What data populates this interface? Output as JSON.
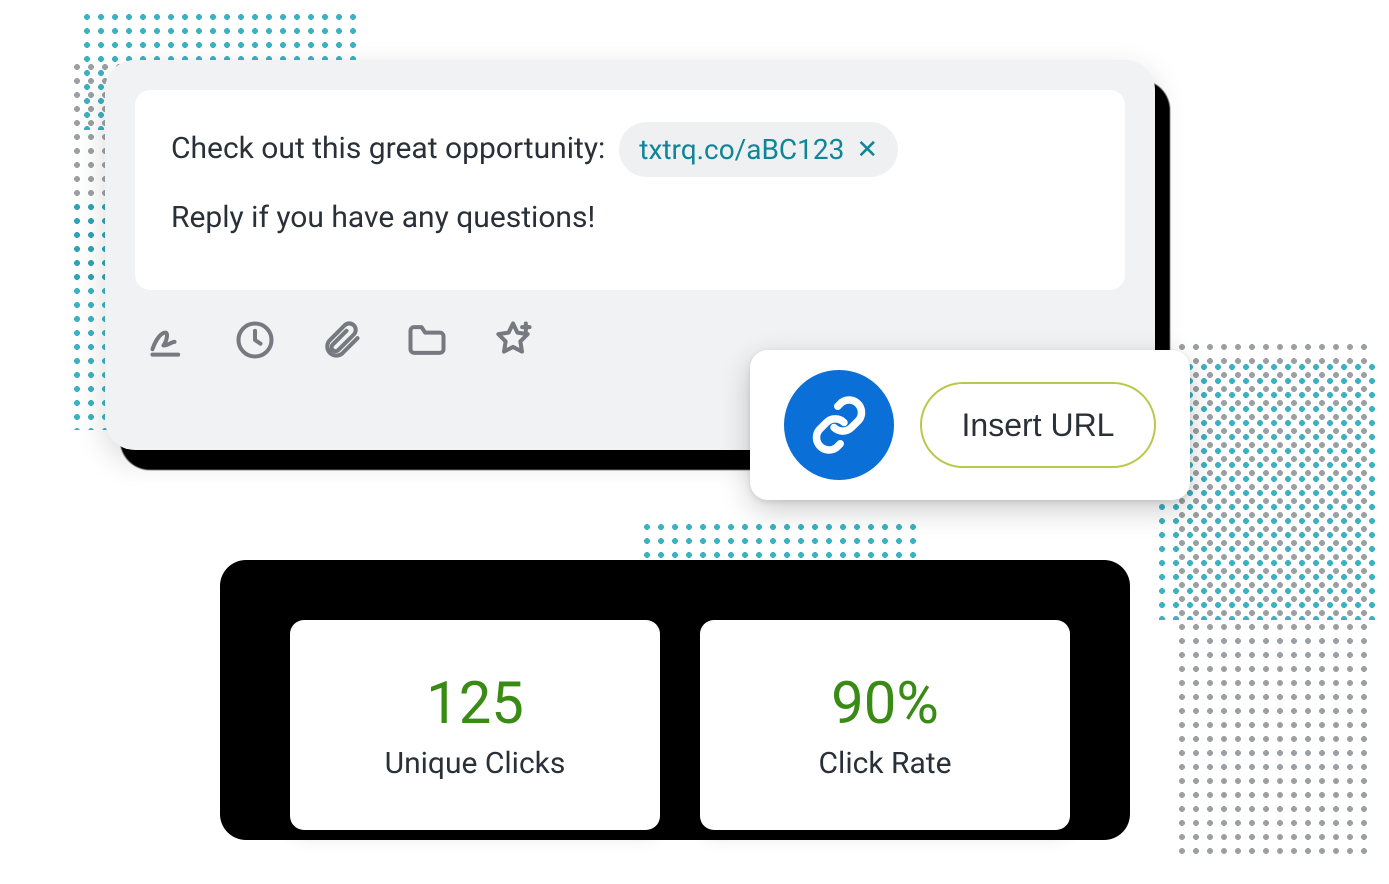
{
  "composer": {
    "line1": "Check out this great opportunity:",
    "short_url": "txtrq.co/aBC123",
    "line2": "Reply if you have any questions!"
  },
  "toolbar": {
    "icons": [
      "signature-icon",
      "clock-icon",
      "attachment-icon",
      "folder-icon",
      "star-plus-icon"
    ]
  },
  "popover": {
    "insert_label": "Insert URL"
  },
  "stats": [
    {
      "value": "125",
      "label": "Unique Clicks"
    },
    {
      "value": "90%",
      "label": "Click Rate"
    }
  ],
  "colors": {
    "accent_teal": "#0f8597",
    "accent_blue": "#0a6fd6",
    "accent_green": "#3a8a16",
    "pill_border": "#b9c84b"
  }
}
